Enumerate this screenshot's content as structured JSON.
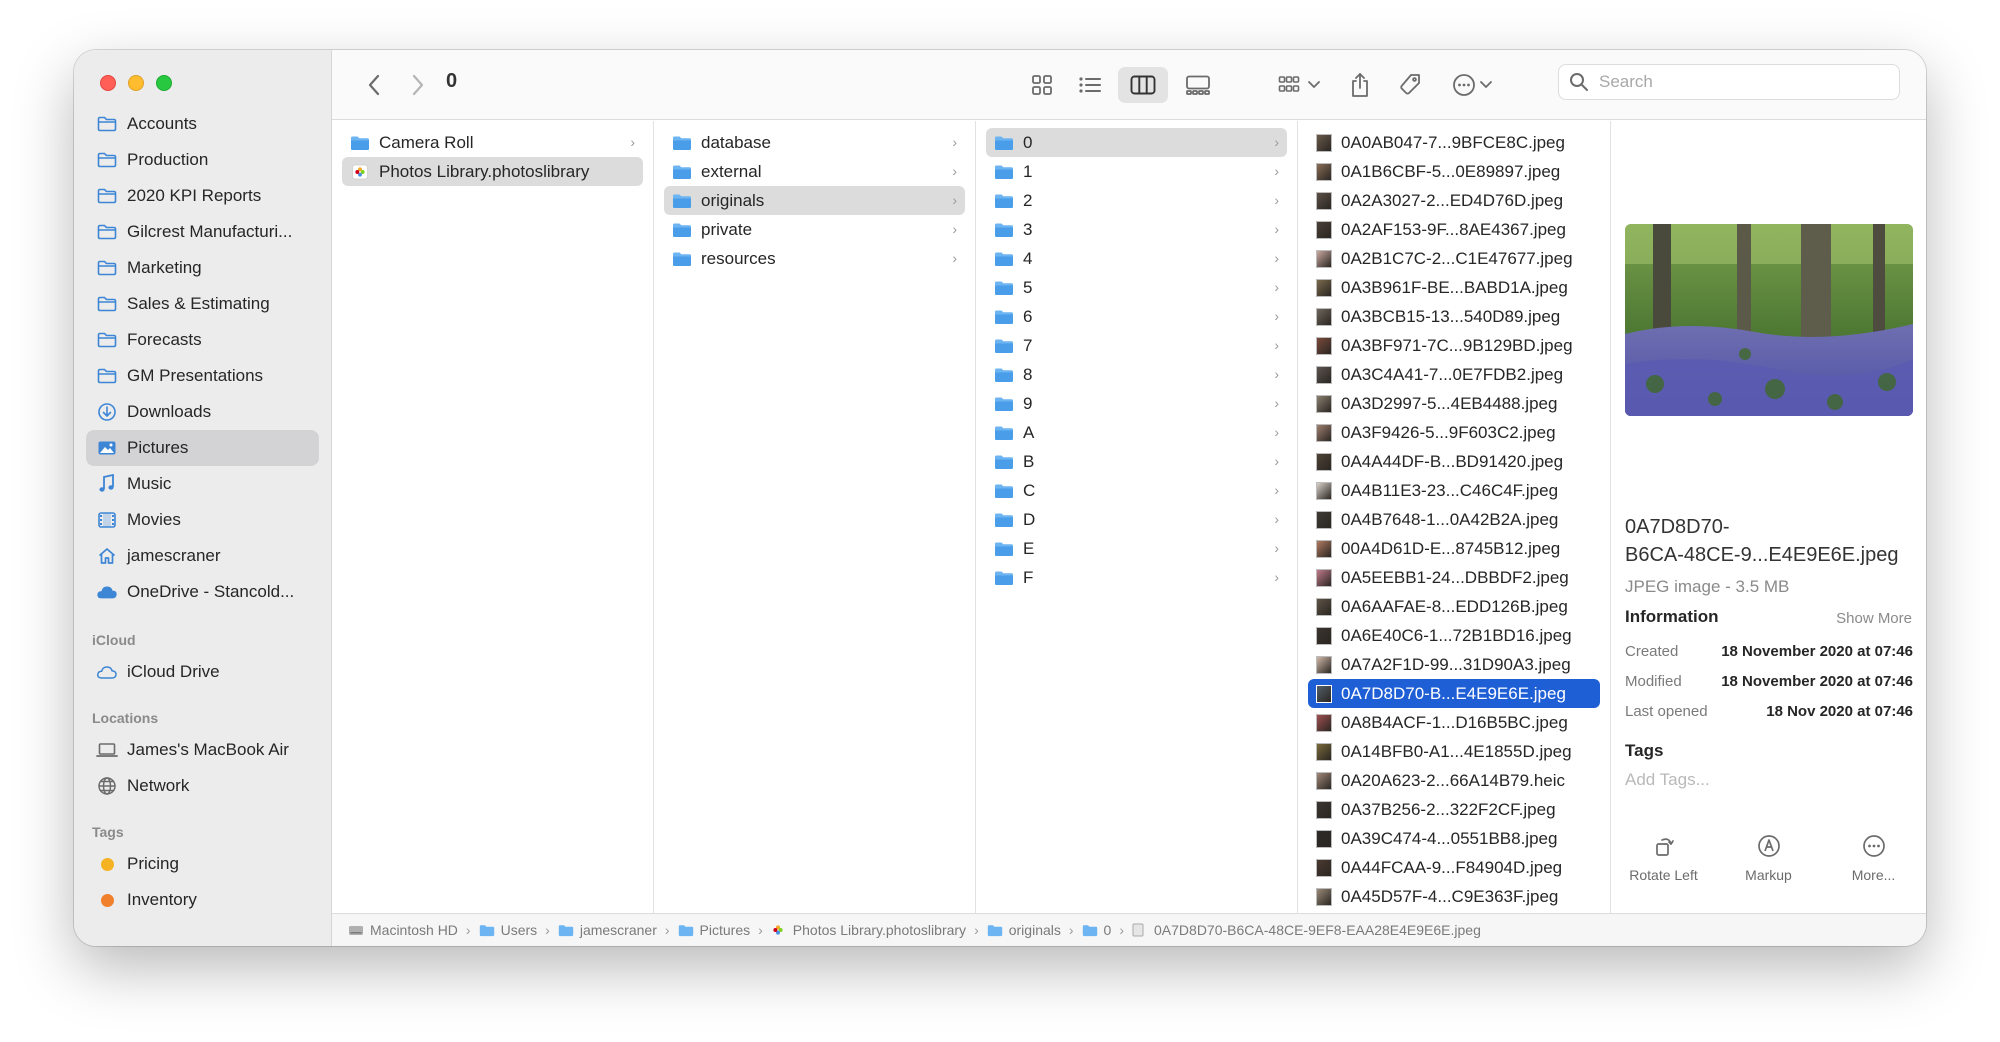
{
  "window": {
    "title": "0"
  },
  "sidebar": {
    "favorites": [
      {
        "label": "Accounts",
        "icon": "folder-icon"
      },
      {
        "label": "Production",
        "icon": "folder-icon"
      },
      {
        "label": "2020 KPI Reports",
        "icon": "folder-icon"
      },
      {
        "label": "Gilcrest Manufacturi...",
        "icon": "folder-icon"
      },
      {
        "label": "Marketing",
        "icon": "folder-icon"
      },
      {
        "label": "Sales & Estimating",
        "icon": "folder-icon"
      },
      {
        "label": "Forecasts",
        "icon": "folder-icon"
      },
      {
        "label": "GM Presentations",
        "icon": "folder-icon"
      },
      {
        "label": "Downloads",
        "icon": "download-icon"
      },
      {
        "label": "Pictures",
        "icon": "pictures-icon",
        "selected": true
      },
      {
        "label": "Music",
        "icon": "music-icon"
      },
      {
        "label": "Movies",
        "icon": "movies-icon"
      },
      {
        "label": "jamescraner",
        "icon": "home-icon"
      },
      {
        "label": "OneDrive - Stancold...",
        "icon": "cloud-icon"
      }
    ],
    "icloud_header": "iCloud",
    "icloud": [
      {
        "label": "iCloud Drive",
        "icon": "icloud-icon"
      }
    ],
    "locations_header": "Locations",
    "locations": [
      {
        "label": "James's MacBook Air",
        "icon": "laptop-icon"
      },
      {
        "label": "Network",
        "icon": "network-icon"
      }
    ],
    "tags_header": "Tags",
    "tags": [
      {
        "label": "Pricing",
        "color": "#f5b323"
      },
      {
        "label": "Inventory",
        "color": "#f0802c"
      }
    ]
  },
  "toolbar": {
    "title": "0",
    "search_placeholder": "Search"
  },
  "columns": {
    "col1": [
      {
        "label": "Camera Roll",
        "type": "folder",
        "chevron": true
      },
      {
        "label": "Photos Library.photoslibrary",
        "type": "photos",
        "selected": true
      }
    ],
    "col2": [
      {
        "label": "database",
        "type": "folder",
        "chevron": true
      },
      {
        "label": "external",
        "type": "folder",
        "chevron": true
      },
      {
        "label": "originals",
        "type": "folder",
        "chevron": true,
        "selected": true
      },
      {
        "label": "private",
        "type": "folder",
        "chevron": true
      },
      {
        "label": "resources",
        "type": "folder",
        "chevron": true
      }
    ],
    "col3": [
      {
        "label": "0",
        "selected": true
      },
      {
        "label": "1"
      },
      {
        "label": "2"
      },
      {
        "label": "3"
      },
      {
        "label": "4"
      },
      {
        "label": "5"
      },
      {
        "label": "6"
      },
      {
        "label": "7"
      },
      {
        "label": "8"
      },
      {
        "label": "9"
      },
      {
        "label": "A"
      },
      {
        "label": "B"
      },
      {
        "label": "C"
      },
      {
        "label": "D"
      },
      {
        "label": "E"
      },
      {
        "label": "F"
      }
    ],
    "col4": [
      "0A0AB047-7...9BFCE8C.jpeg",
      "0A1B6CBF-5...0E89897.jpeg",
      "0A2A3027-2...ED4D76D.jpeg",
      "0A2AF153-9F...8AE4367.jpeg",
      "0A2B1C7C-2...C1E47677.jpeg",
      "0A3B961F-BE...BABD1A.jpeg",
      "0A3BCB15-13...540D89.jpeg",
      "0A3BF971-7C...9B129BD.jpeg",
      "0A3C4A41-7...0E7FDB2.jpeg",
      "0A3D2997-5...4EB4488.jpeg",
      "0A3F9426-5...9F603C2.jpeg",
      "0A4A44DF-B...BD91420.jpeg",
      "0A4B11E3-23...C46C4F.jpeg",
      "0A4B7648-1...0A42B2A.jpeg",
      "00A4D61D-E...8745B12.jpeg",
      "0A5EEBB1-24...DBBDF2.jpeg",
      "0A6AAFAE-8...EDD126B.jpeg",
      "0A6E40C6-1...72B1BD16.jpeg",
      "0A7A2F1D-99...31D90A3.jpeg",
      "0A7D8D70-B...E4E9E6E.jpeg",
      "0A8B4ACF-1...D16B5BC.jpeg",
      "0A14BFB0-A1...4E1855D.jpeg",
      "0A20A623-2...66A14B79.heic",
      "0A37B256-2...322F2CF.jpeg",
      "0A39C474-4...0551BB8.jpeg",
      "0A44FCAA-9...F84904D.jpeg",
      "0A45D57F-4...C9E363F.jpeg"
    ],
    "col4_active_index": 19
  },
  "preview": {
    "name_line1": "0A7D8D70-",
    "name_line2": "B6CA-48CE-9...E4E9E6E.jpeg",
    "kind": "JPEG image - 3.5 MB",
    "info_header": "Information",
    "show_more": "Show More",
    "meta": [
      {
        "key": "Created",
        "value": "18 November 2020 at 07:46"
      },
      {
        "key": "Modified",
        "value": "18 November 2020 at 07:46"
      },
      {
        "key": "Last opened",
        "value": "18 Nov 2020 at 07:46"
      }
    ],
    "tags_header": "Tags",
    "tags_placeholder": "Add Tags...",
    "actions": [
      {
        "label": "Rotate Left",
        "icon": "rotate-left-icon"
      },
      {
        "label": "Markup",
        "icon": "markup-icon"
      },
      {
        "label": "More...",
        "icon": "more-icon"
      }
    ]
  },
  "pathbar": [
    {
      "label": "Macintosh HD",
      "icon": "disk-icon"
    },
    {
      "label": "Users",
      "icon": "folder-icon"
    },
    {
      "label": "jamescraner",
      "icon": "folder-icon"
    },
    {
      "label": "Pictures",
      "icon": "folder-icon"
    },
    {
      "label": "Photos Library.photoslibrary",
      "icon": "photos-icon"
    },
    {
      "label": "originals",
      "icon": "folder-icon"
    },
    {
      "label": "0",
      "icon": "folder-icon"
    },
    {
      "label": "0A7D8D70-B6CA-48CE-9EF8-EAA28E4E9E6E.jpeg",
      "icon": "file-icon"
    }
  ],
  "colors": {
    "accent": "#1f5fd6",
    "folder": "#5aaaf0"
  }
}
